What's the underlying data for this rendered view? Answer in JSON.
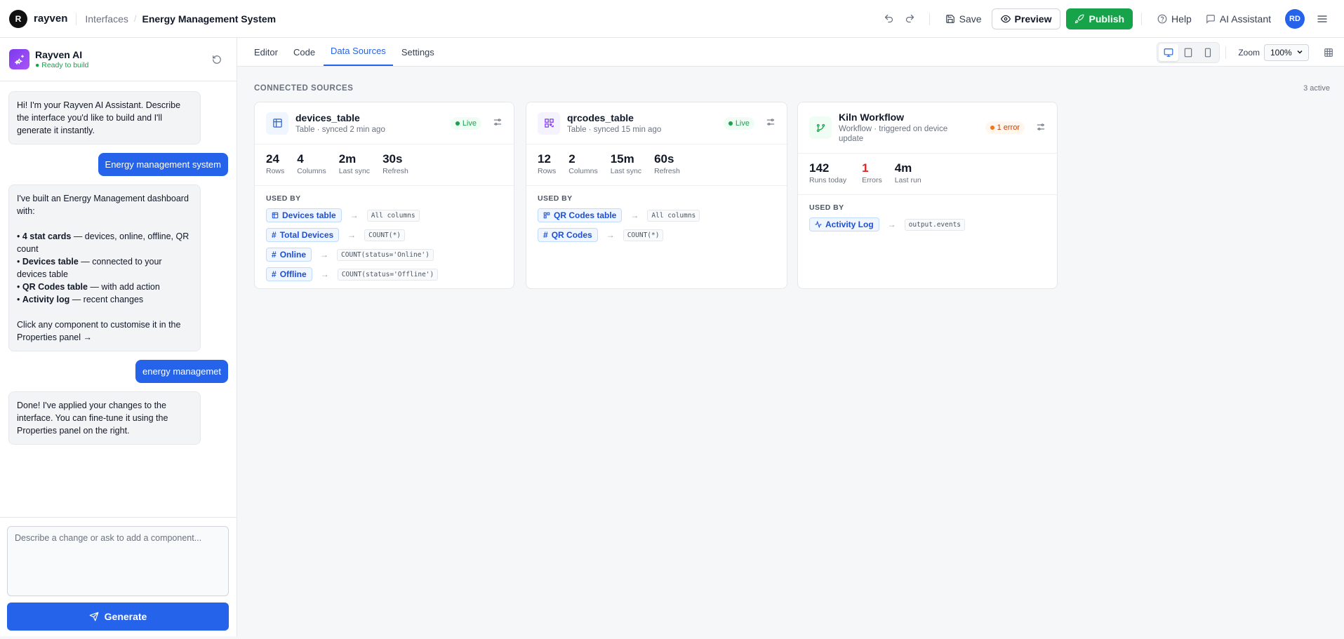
{
  "topbar": {
    "logo_letter": "R",
    "brand": "rayven",
    "breadcrumb": "Interfaces",
    "title": "Energy Management System",
    "save": "Save",
    "preview": "Preview",
    "publish": "Publish",
    "help": "Help",
    "assistant": "AI Assistant",
    "avatar": "RD"
  },
  "ai_panel": {
    "name": "Rayven AI",
    "status": "● Ready to build",
    "messages": [
      {
        "role": "ai",
        "text": "Hi! I'm your Rayven AI Assistant. Describe the interface you'd like to build and I'll generate it instantly."
      },
      {
        "role": "user",
        "text": "Energy management system"
      },
      {
        "role": "ai",
        "intro": "I've built an Energy Management dashboard with:",
        "bullets": [
          {
            "bold": "4 stat cards",
            "rest": " — devices, online, offline, QR count"
          },
          {
            "bold": "Devices table",
            "rest": " — connected to your devices table"
          },
          {
            "bold": "QR Codes table",
            "rest": " — with add action"
          },
          {
            "bold": "Activity log",
            "rest": " — recent changes"
          }
        ],
        "outro": "Click any component to customise it in the Properties panel →"
      },
      {
        "role": "user",
        "text": "energy managemet"
      },
      {
        "role": "ai",
        "text": "Done! I've applied your changes to the interface. You can fine-tune it using the Properties panel on the right."
      }
    ],
    "input_placeholder": "Describe a change or ask to add a component...",
    "generate": "Generate"
  },
  "tabs": [
    {
      "label": "Editor",
      "active": false
    },
    {
      "label": "Code",
      "active": false
    },
    {
      "label": "Data Sources",
      "active": true
    },
    {
      "label": "Settings",
      "active": false
    }
  ],
  "toolbar": {
    "zoom_label": "Zoom",
    "zoom_value": "100%"
  },
  "sources": {
    "section_title": "CONNECTED SOURCES",
    "active_count": "3 active",
    "used_by_title": "USED BY",
    "cards": [
      {
        "name": "devices_table",
        "subtitle": "Table · synced 2 min ago",
        "badge": "Live",
        "icon": "table-icon",
        "stats": [
          {
            "value": "24",
            "label": "Rows"
          },
          {
            "value": "4",
            "label": "Columns"
          },
          {
            "value": "2m",
            "label": "Last sync"
          },
          {
            "value": "30s",
            "label": "Refresh"
          }
        ],
        "used_by": [
          {
            "component": "Devices table",
            "icon": "table-icon",
            "binding": "All columns"
          },
          {
            "component": "Total Devices",
            "icon": "hash-icon",
            "binding": "COUNT(*)"
          },
          {
            "component": "Online",
            "icon": "hash-icon",
            "binding": "COUNT(status='Online')"
          },
          {
            "component": "Offline",
            "icon": "hash-icon",
            "binding": "COUNT(status='Offline')"
          }
        ]
      },
      {
        "name": "qrcodes_table",
        "subtitle": "Table · synced 15 min ago",
        "badge": "Live",
        "icon": "qr-icon",
        "stats": [
          {
            "value": "12",
            "label": "Rows"
          },
          {
            "value": "2",
            "label": "Columns"
          },
          {
            "value": "15m",
            "label": "Last sync"
          },
          {
            "value": "60s",
            "label": "Refresh"
          }
        ],
        "used_by": [
          {
            "component": "QR Codes table",
            "icon": "qr-icon",
            "binding": "All columns"
          },
          {
            "component": "QR Codes",
            "icon": "hash-icon",
            "binding": "COUNT(*)"
          }
        ]
      },
      {
        "name": "Kiln Workflow",
        "subtitle": "Workflow · triggered on device update",
        "badge": "1 error",
        "icon": "workflow-icon",
        "stats": [
          {
            "value": "142",
            "label": "Runs today"
          },
          {
            "value": "1",
            "label": "Errors",
            "red": true
          },
          {
            "value": "4m",
            "label": "Last run"
          }
        ],
        "used_by": [
          {
            "component": "Activity Log",
            "icon": "activity-icon",
            "binding": "output.events"
          }
        ]
      }
    ]
  }
}
